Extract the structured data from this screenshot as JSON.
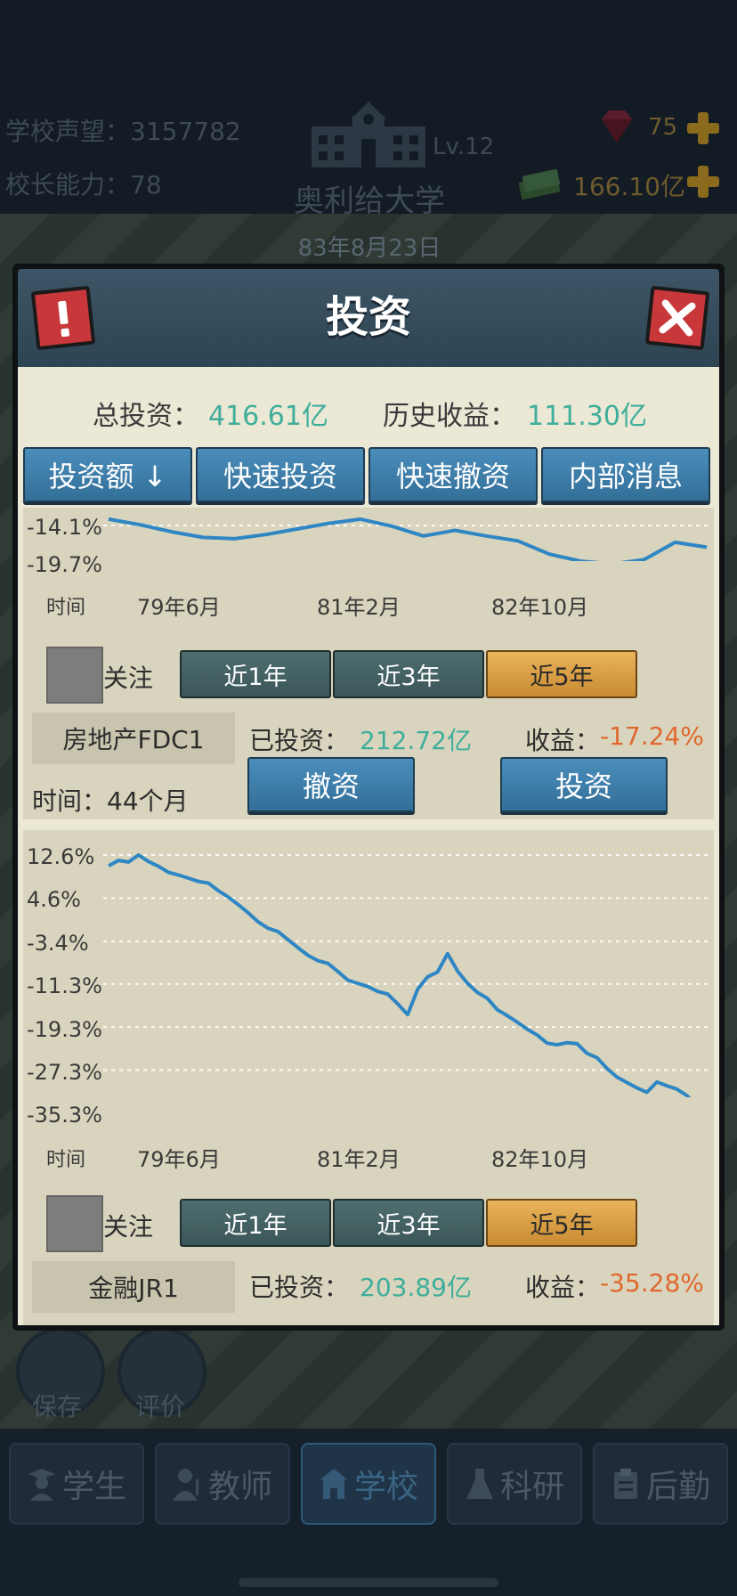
{
  "hud": {
    "reputation": "学校声望：3157782",
    "ability": "校长能力：78",
    "level": "Lv.12",
    "school_name": "奥利给大学",
    "date": "83年8月23日",
    "gems": "75",
    "money": "166.10亿"
  },
  "modal": {
    "title": "投资",
    "total_label": "总投资：",
    "total_value": "416.61亿",
    "history_label": "历史收益：",
    "history_value": "111.30亿",
    "tabs": [
      "投资额 ↓",
      "快速投资",
      "快速撤资",
      "内部消息"
    ]
  },
  "funds": [
    {
      "y_ticks": [
        "-14.1%",
        "-19.7%"
      ],
      "time_label": "时间",
      "x_ticks": [
        "79年6月",
        "81年2月",
        "82年10月"
      ],
      "follow_label": "关注",
      "ranges": [
        "近1年",
        "近3年",
        "近5年"
      ],
      "active_range": 2,
      "name": "房地产FDC1",
      "invested_label": "已投资：",
      "invested_value": "212.72亿",
      "return_label": "收益：",
      "return_value": "-17.24%",
      "duration": "时间：44个月",
      "withdraw_label": "撤资",
      "invest_label": "投资"
    },
    {
      "y_ticks": [
        "12.6%",
        "4.6%",
        "-3.4%",
        "-11.3%",
        "-19.3%",
        "-27.3%",
        "-35.3%"
      ],
      "time_label": "时间",
      "x_ticks": [
        "79年6月",
        "81年2月",
        "82年10月"
      ],
      "follow_label": "关注",
      "ranges": [
        "近1年",
        "近3年",
        "近5年"
      ],
      "active_range": 2,
      "name": "金融JR1",
      "invested_label": "已投资：",
      "invested_value": "203.89亿",
      "return_label": "收益：",
      "return_value": "-35.28%"
    }
  ],
  "chart_data": [
    {
      "type": "line",
      "series": [
        {
          "values": [
            -13.2,
            -14.0,
            -15.0,
            -15.8,
            -16.0,
            -15.4,
            -14.6,
            -13.8,
            -13.2,
            -14.2,
            -15.6,
            -14.8,
            -15.6,
            -16.3,
            -18.2,
            -19.2,
            -19.6,
            -19.0,
            -16.5,
            -17.2
          ]
        }
      ],
      "x_labels": [
        "79年6月",
        "81年2月",
        "82年10月"
      ],
      "y_ticks": [
        -14.1,
        -19.7
      ]
    },
    {
      "type": "line",
      "series": [
        {
          "values": [
            10.6,
            11.6,
            11.3,
            12.6,
            11.4,
            10.5,
            9.4,
            8.9,
            8.3,
            7.7,
            7.4,
            6.0,
            4.8,
            3.4,
            1.9,
            0.2,
            -1.0,
            -1.6,
            -3.1,
            -4.6,
            -6.0,
            -7.0,
            -7.5,
            -9.0,
            -10.6,
            -11.2,
            -11.8,
            -12.7,
            -13.2,
            -15.0,
            -17.0,
            -12.3,
            -10.0,
            -9.1,
            -5.7,
            -8.9,
            -11.2,
            -12.9,
            -14.0,
            -16.1,
            -17.2,
            -18.4,
            -19.7,
            -20.8,
            -22.3,
            -22.6,
            -22.2,
            -22.4,
            -24.2,
            -25.0,
            -27.0,
            -28.6,
            -29.6,
            -30.6,
            -31.4,
            -29.5,
            -30.2,
            -30.8,
            -32.0,
            -34.0,
            -35.3
          ]
        }
      ],
      "x_labels": [
        "79年6月",
        "81年2月",
        "82年10月"
      ],
      "y_ticks": [
        12.6,
        4.6,
        -3.4,
        -11.3,
        -19.3,
        -27.3,
        -35.3
      ]
    }
  ],
  "bottom_nav": [
    "学生",
    "教师",
    "学校",
    "科研",
    "后勤"
  ],
  "background": {
    "save_label": "保存",
    "review_label": "评价"
  },
  "colors": {
    "accent_blue": "#3a86b5",
    "value_green": "#3fae9a",
    "loss_orange": "#e0682f",
    "active_range": "#e2a64b",
    "line_color": "#2f86c4"
  }
}
